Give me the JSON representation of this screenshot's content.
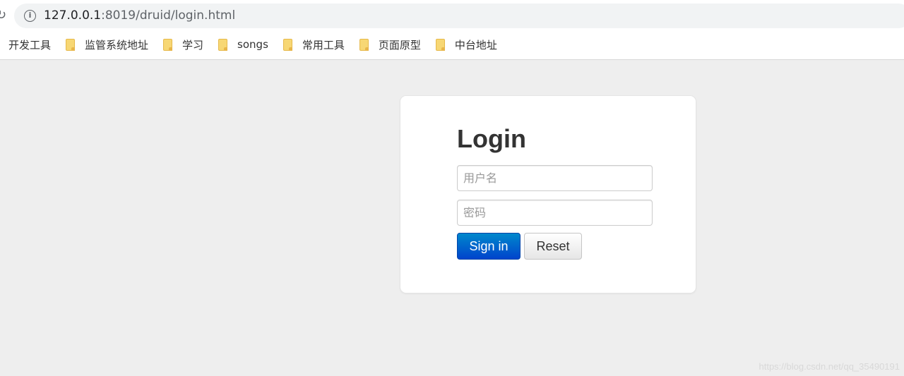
{
  "browser": {
    "url_host": "127.0.0.1",
    "url_rest": ":8019/druid/login.html",
    "reload_icon": "reload-icon",
    "info_icon": "info-icon"
  },
  "bookmarks": [
    {
      "label": "开发工具",
      "icon": "folder-icon"
    },
    {
      "label": "监管系统地址",
      "icon": "folder-icon"
    },
    {
      "label": "学习",
      "icon": "folder-icon"
    },
    {
      "label": "songs",
      "icon": "folder-icon"
    },
    {
      "label": "常用工具",
      "icon": "folder-icon"
    },
    {
      "label": "页面原型",
      "icon": "folder-icon"
    },
    {
      "label": "中台地址",
      "icon": "folder-icon"
    }
  ],
  "login": {
    "title": "Login",
    "username_placeholder": "用户名",
    "password_placeholder": "密码",
    "signin_label": "Sign in",
    "reset_label": "Reset"
  },
  "watermark": "https://blog.csdn.net/qq_35490191",
  "colors": {
    "page_background": "#eeeeee",
    "primary_button": "#0055cc",
    "folder": "#f7d774"
  }
}
